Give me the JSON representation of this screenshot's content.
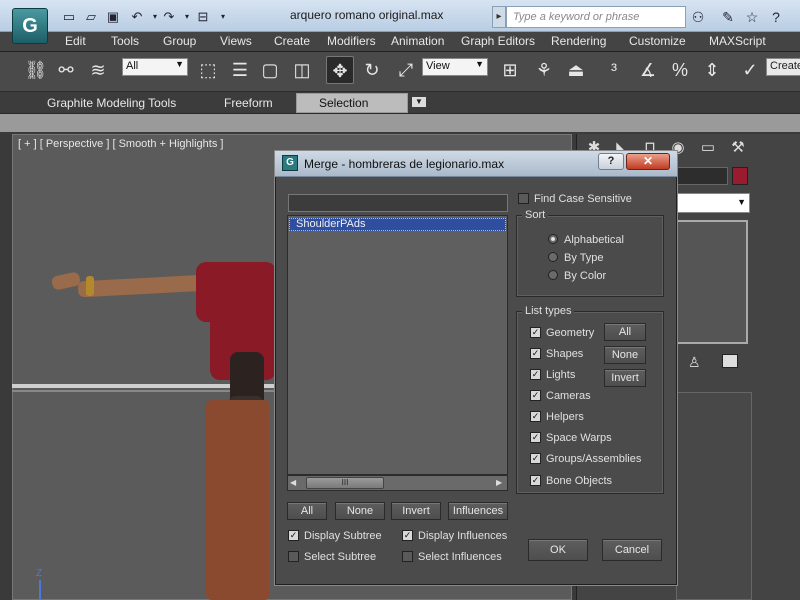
{
  "window": {
    "title": "arquero romano original.max",
    "search_placeholder": "Type a keyword or phrase",
    "logo_icon": "3dsmax-logo-icon"
  },
  "menu": [
    "Edit",
    "Tools",
    "Group",
    "Views",
    "Create",
    "Modifiers",
    "Animation",
    "Graph Editors",
    "Rendering",
    "Customize",
    "MAXScript"
  ],
  "toolbar": {
    "selection_filter": "All",
    "ref_coord": "View",
    "create_field": "Create"
  },
  "ribbon": {
    "tabs": [
      "Graphite Modeling Tools",
      "Freeform",
      "Selection"
    ],
    "active_tab": "Selection"
  },
  "viewport": {
    "label": "[ + ] [ Perspective ] [ Smooth + Highlights ]",
    "axis_label": "Z"
  },
  "dialog": {
    "title": "Merge - hombreras de legionario.max",
    "help_label": "?",
    "close_label": "✕",
    "filter_value": "",
    "list_items": [
      "ShoulderPAds"
    ],
    "selected_index": 0,
    "scroll_thumb": "III",
    "list_buttons": {
      "all": "All",
      "none": "None",
      "invert": "Invert",
      "influences": "Influences"
    },
    "display_subtree": {
      "label": "Display Subtree",
      "checked": true
    },
    "select_subtree": {
      "label": "Select Subtree",
      "checked": false
    },
    "display_influences": {
      "label": "Display Influences",
      "checked": true
    },
    "select_influences": {
      "label": "Select Influences",
      "checked": false
    },
    "find_case_sensitive": {
      "label": "Find Case Sensitive",
      "checked": false
    },
    "sort": {
      "title": "Sort",
      "options": [
        "Alphabetical",
        "By Type",
        "By Color"
      ],
      "selected": "Alphabetical"
    },
    "list_types": {
      "title": "List types",
      "items": [
        {
          "label": "Geometry",
          "checked": true
        },
        {
          "label": "Shapes",
          "checked": true
        },
        {
          "label": "Lights",
          "checked": true
        },
        {
          "label": "Cameras",
          "checked": true
        },
        {
          "label": "Helpers",
          "checked": true
        },
        {
          "label": "Space Warps",
          "checked": true
        },
        {
          "label": "Groups/Assemblies",
          "checked": true
        },
        {
          "label": "Bone Objects",
          "checked": true
        }
      ],
      "buttons": {
        "all": "All",
        "none": "None",
        "invert": "Invert"
      }
    },
    "ok_label": "OK",
    "cancel_label": "Cancel"
  },
  "colors": {
    "object_color": "#9a1a30",
    "selection_highlight": "#2f4f9e"
  }
}
